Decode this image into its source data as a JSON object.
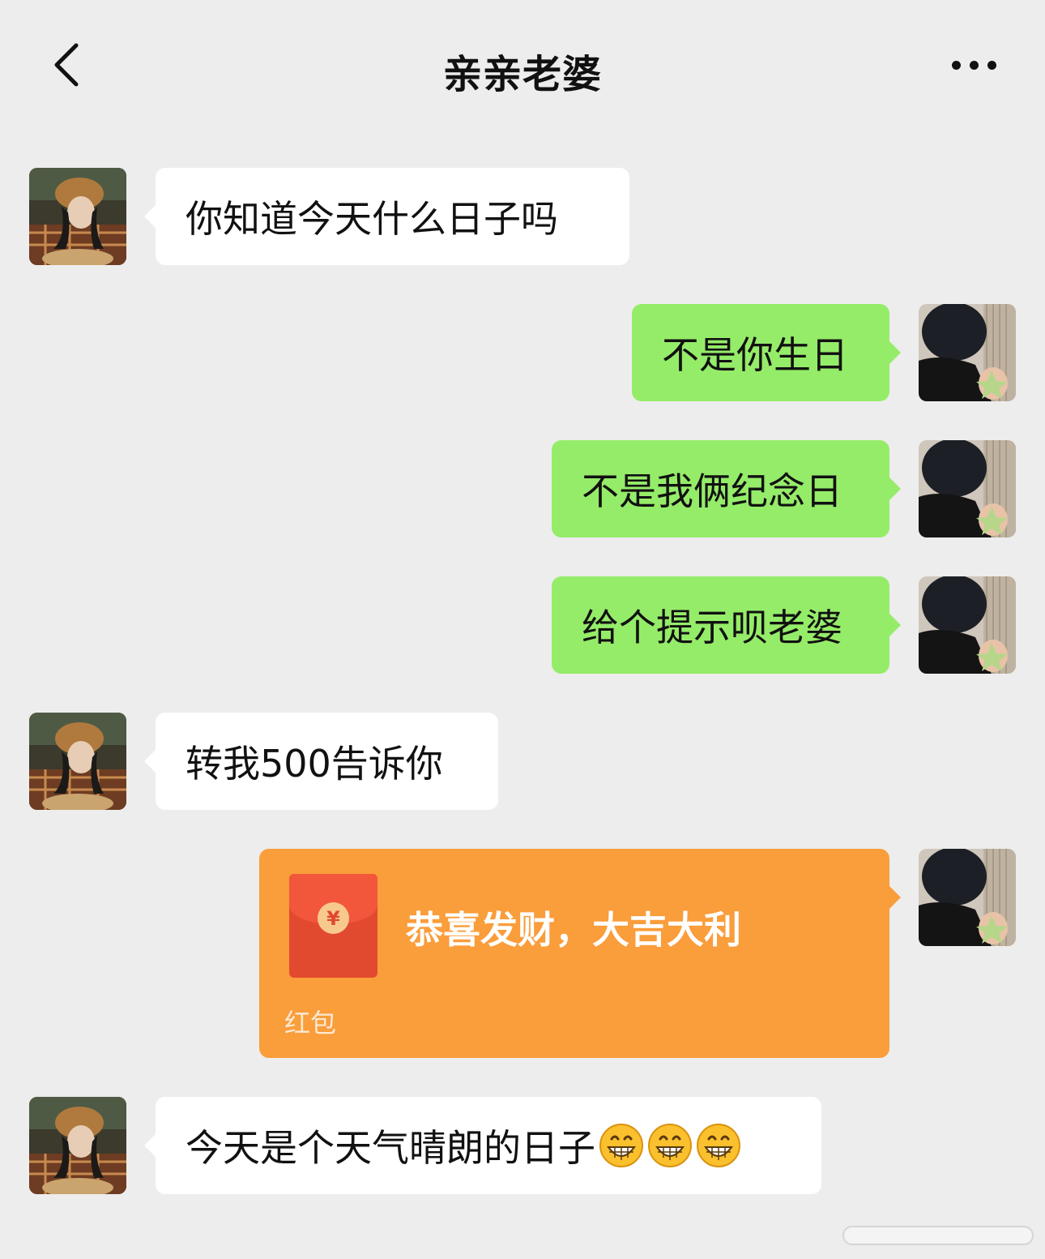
{
  "header": {
    "title": "亲亲老婆",
    "back_icon": "chevron-left-icon",
    "more_icon": "more-horizontal-icon"
  },
  "colors": {
    "background": "#ededed",
    "incoming_bubble": "#ffffff",
    "outgoing_bubble": "#95ec69",
    "red_packet": "#fa9d3b",
    "envelope": "#e24a2f"
  },
  "messages": [
    {
      "sender": "contact",
      "text": "你知道今天什么日子吗"
    },
    {
      "sender": "me",
      "text": "不是你生日"
    },
    {
      "sender": "me",
      "text": "不是我俩纪念日"
    },
    {
      "sender": "me",
      "text": "给个提示呗老婆"
    },
    {
      "sender": "contact",
      "text": "转我500告诉你"
    },
    {
      "sender": "me",
      "type": "red_packet",
      "greeting": "恭喜发财，大吉大利",
      "label": "红包",
      "icon": "red-envelope-icon",
      "coin_symbol": "¥"
    },
    {
      "sender": "contact",
      "text": "今天是个天气晴朗的日子",
      "emoji": "grinning-face-icon",
      "emoji_count": 3
    }
  ]
}
